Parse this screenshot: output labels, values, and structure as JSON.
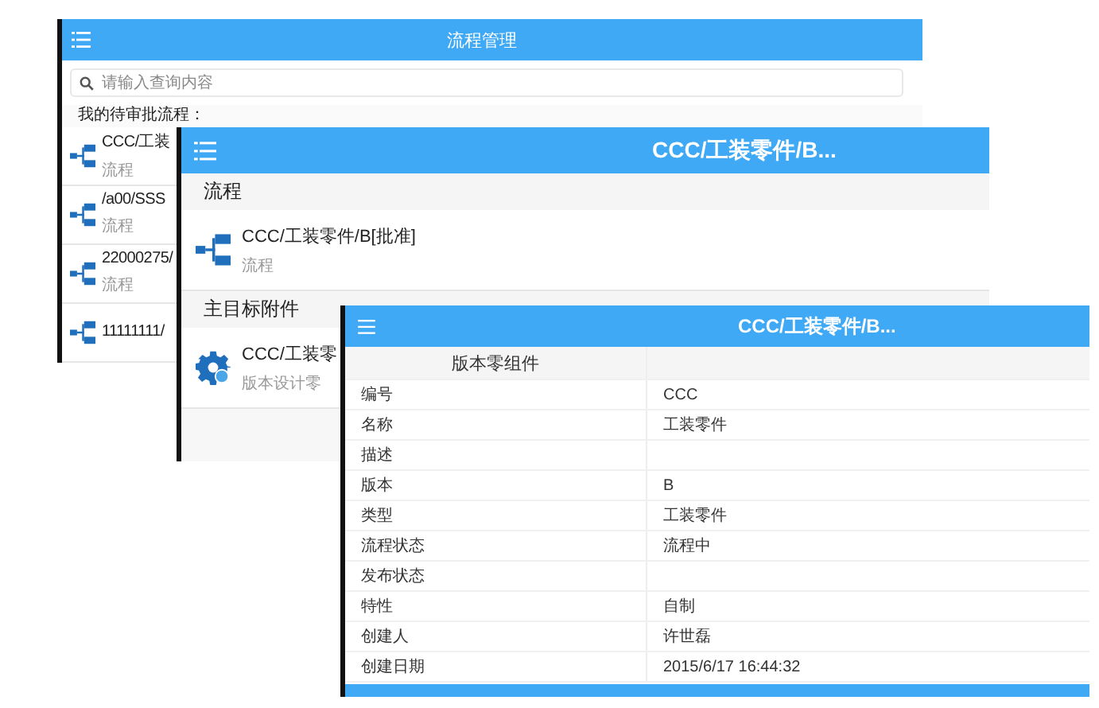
{
  "list_window": {
    "title": "流程管理",
    "search": {
      "placeholder": "请输入查询内容"
    },
    "summary": "我的待审批流程：",
    "items": [
      {
        "title": "CCC/工装",
        "subtitle": "流程"
      },
      {
        "title": "/a00/SSS",
        "subtitle": "流程"
      },
      {
        "title": "22000275/",
        "subtitle": "流程"
      },
      {
        "title": "11111111/"
      }
    ]
  },
  "detail_window": {
    "title": "CCC/工装零件/B...",
    "sections": [
      {
        "heading": "流程",
        "items": [
          {
            "kind": "flow",
            "title": "CCC/工装零件/B[批准]",
            "subtitle": "流程"
          }
        ]
      },
      {
        "heading": "主目标附件",
        "items": [
          {
            "kind": "gear",
            "title": "CCC/工装零",
            "subtitle": "版本设计零"
          }
        ]
      }
    ]
  },
  "table_window": {
    "title": "CCC/工装零件/B...",
    "columns": [
      "版本零组件"
    ],
    "rows": [
      {
        "label": "编号",
        "value": "CCC"
      },
      {
        "label": "名称",
        "value": "工装零件"
      },
      {
        "label": "描述"
      },
      {
        "label": "版本",
        "value": "B"
      },
      {
        "label": "类型",
        "value": "工装零件"
      },
      {
        "label": "流程状态",
        "value": "流程中"
      },
      {
        "label": "发布状态"
      },
      {
        "label": "特性",
        "value": "自制"
      },
      {
        "label": "创建人",
        "value": "许世磊"
      },
      {
        "label": "创建日期",
        "value": "2015/6/17 16:44:32"
      }
    ]
  }
}
